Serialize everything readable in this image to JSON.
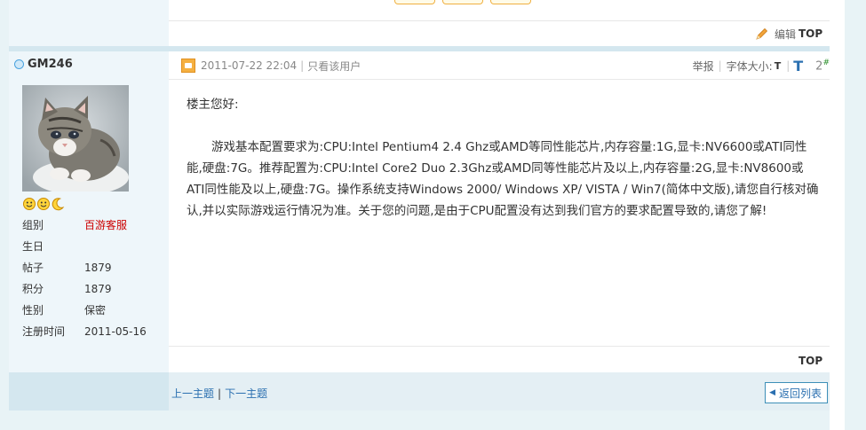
{
  "post": {
    "author": "GM246",
    "datetime": "2011-07-22 22:04",
    "only_user": "只看该用户",
    "report": "举报",
    "font_size_label": "字体大小:",
    "font_small": "T",
    "font_large": "T",
    "floor_number": "2",
    "floor_suffix": "#",
    "greeting": "楼主您好:",
    "body": "游戏基本配置要求为:CPU:Intel Pentium4 2.4 Ghz或AMD等同性能芯片,内存容量:1G,显卡:NV6600或ATI同性能,硬盘:7G。推荐配置为:CPU:Intel Core2 Duo 2.3Ghz或AMD同等性能芯片及以上,内存容量:2G,显卡:NV8600或ATI同性能及以上,硬盘:7G。操作系统支持Windows 2000/ Windows XP/ VISTA / Win7(简体中文版),请您自行核对确认,并以实际游戏运行情况为准。关于您的问题,是由于CPU配置没有达到我们官方的要求配置导致的,请您了解!",
    "top_label": "TOP"
  },
  "previous_post": {
    "edit_label": "编辑",
    "top_label": "TOP"
  },
  "profile": {
    "rows": [
      {
        "label": "组别",
        "value": "百游客服"
      },
      {
        "label": "生日",
        "value": ""
      },
      {
        "label": "帖子",
        "value": "1879"
      },
      {
        "label": "积分",
        "value": "1879"
      },
      {
        "label": "性别",
        "value": "保密"
      },
      {
        "label": "注册时间",
        "value": "2011-05-16"
      }
    ]
  },
  "navigation": {
    "prev_thread": "上一主题",
    "divider": "|",
    "next_thread": "下一主题",
    "back_to_list": "返回列表"
  },
  "icons": {
    "online": "online-status-icon",
    "rank": [
      "smile-icon",
      "smile-icon",
      "moon-icon"
    ],
    "edit": "pencil-icon",
    "post": "post-icon",
    "back": "arrow-left-icon"
  },
  "colors": {
    "link": "#2a6fb0",
    "group_red": "#cc0000",
    "sidebar_bg": "#eef6fa",
    "page_bg": "#e8f3f6"
  }
}
